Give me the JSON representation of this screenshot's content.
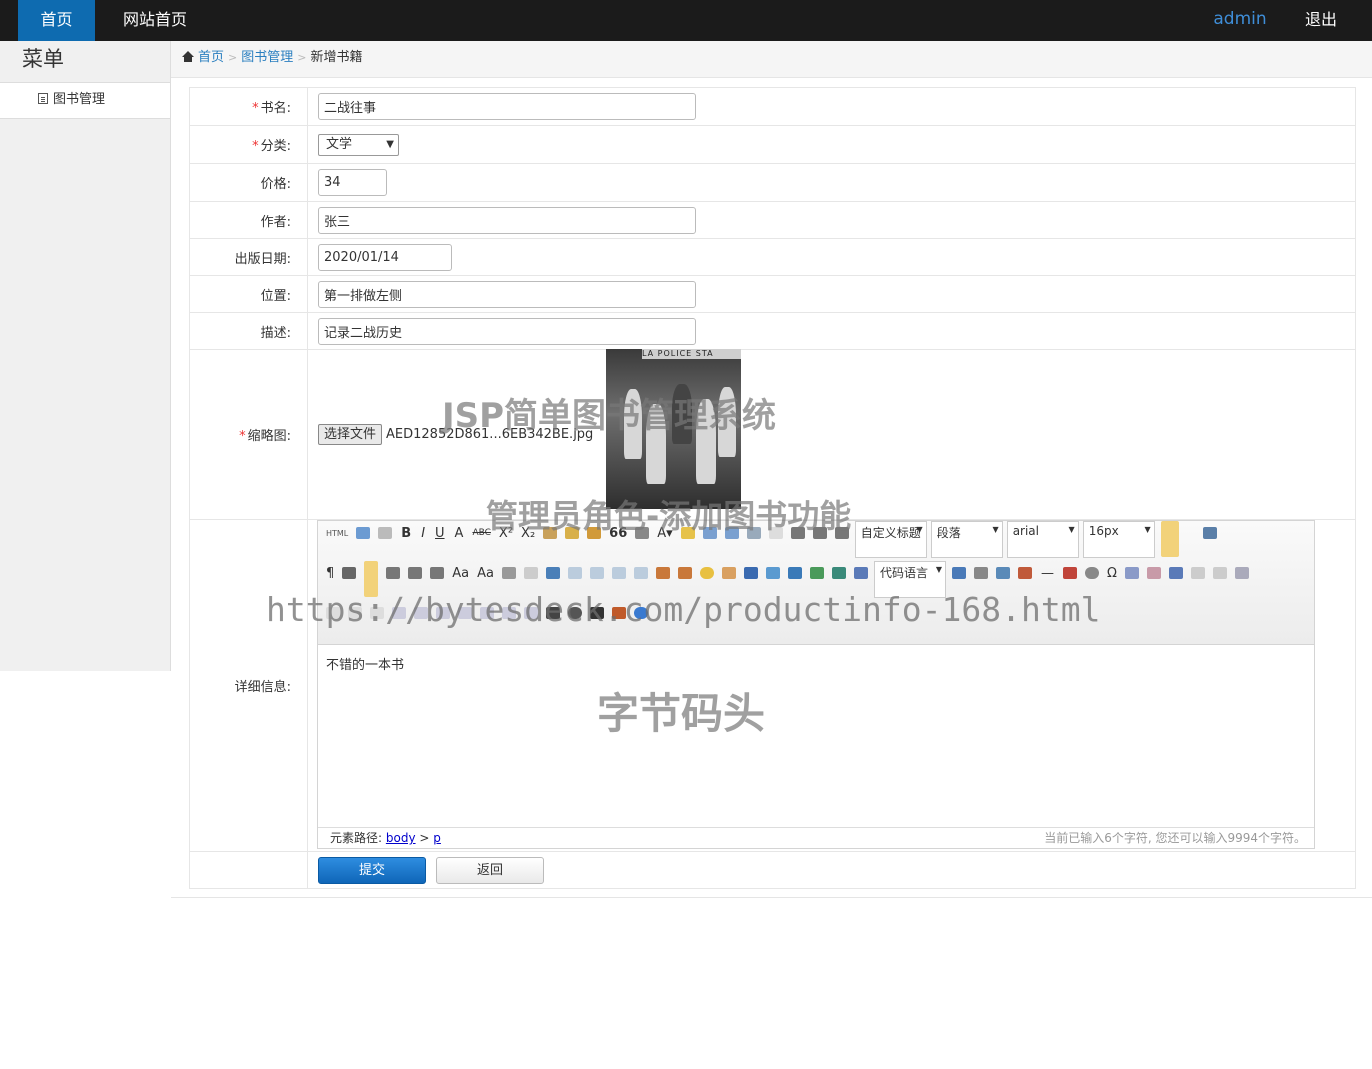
{
  "topnav": {
    "home": "首页",
    "site": "网站首页",
    "user": "admin",
    "logout": "退出"
  },
  "sidebar": {
    "title": "菜单",
    "items": [
      {
        "label": "图书管理"
      }
    ]
  },
  "breadcrumb": {
    "home": "首页",
    "section": "图书管理",
    "current": "新增书籍"
  },
  "form": {
    "name": {
      "label": "书名:",
      "value": "二战往事",
      "required": true
    },
    "category": {
      "label": "分类:",
      "value": "文学",
      "required": true
    },
    "price": {
      "label": "价格:",
      "value": "34"
    },
    "author": {
      "label": "作者:",
      "value": "张三"
    },
    "pub_date": {
      "label": "出版日期:",
      "value": "2020/01/14"
    },
    "location": {
      "label": "位置:",
      "value": "第一排做左侧"
    },
    "desc": {
      "label": "描述:",
      "value": "记录二战历史"
    },
    "thumb": {
      "label": "缩略图:",
      "button": "选择文件",
      "filename": "AED12852D861...6EB342BE.jpg",
      "required": true,
      "image_sign": "LA POLICE STA"
    },
    "detail": {
      "label": "详细信息:"
    }
  },
  "editor": {
    "combos": {
      "title_style": "自定义标题",
      "paragraph": "段落",
      "font": "arial",
      "size": "16px",
      "code_lang": "代码语言"
    },
    "content": "不错的一本书",
    "status_path_label": "元素路径:",
    "status_path_body": "body",
    "status_path_sep": ">",
    "status_path_p": "p",
    "char_count": "当前已输入6个字符, 您还可以输入9994个字符。"
  },
  "buttons": {
    "submit": "提交",
    "back": "返回"
  },
  "watermarks": {
    "w1": "JSP简单图书管理系统",
    "w2": "管理员角色-添加图书功能",
    "w3": "https://bytesdeck.com/productinfo-168.html",
    "w4": "字节码头"
  }
}
